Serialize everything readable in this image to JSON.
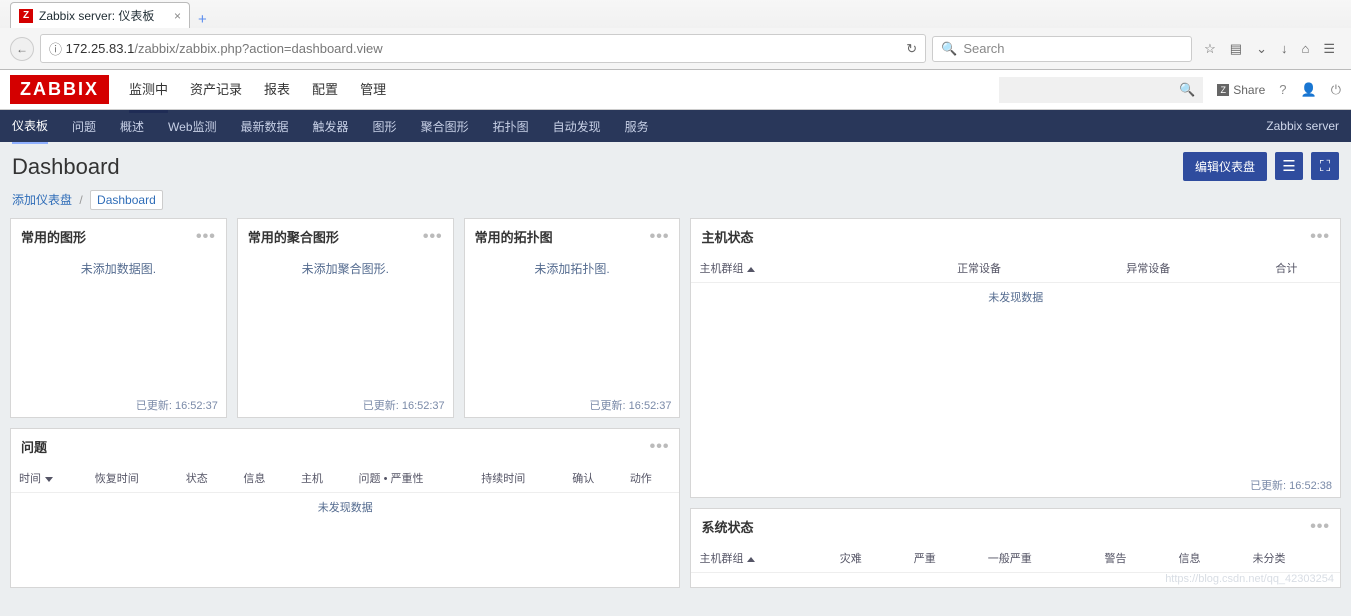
{
  "browser": {
    "tab_title": "Zabbix server: 仪表板",
    "url_host": "172.25.83.1",
    "url_path": "/zabbix/zabbix.php?action=dashboard.view",
    "search_placeholder": "Search"
  },
  "header": {
    "logo": "ZABBIX",
    "nav": [
      "监测中",
      "资产记录",
      "报表",
      "配置",
      "管理"
    ],
    "active_nav": 0,
    "share": "Share",
    "search_placeholder": ""
  },
  "subnav": {
    "items": [
      "仪表板",
      "问题",
      "概述",
      "Web监测",
      "最新数据",
      "触发器",
      "图形",
      "聚合图形",
      "拓扑图",
      "自动发现",
      "服务"
    ],
    "active": 0,
    "server_label": "Zabbix server"
  },
  "page": {
    "title": "Dashboard",
    "edit_btn": "编辑仪表盘",
    "crumb_add": "添加仪表盘",
    "crumb_current": "Dashboard"
  },
  "widgets": {
    "fav_graphs": {
      "title": "常用的图形",
      "empty": "未添加数据图.",
      "updated": "已更新: 16:52:37"
    },
    "fav_screens": {
      "title": "常用的聚合图形",
      "empty": "未添加聚合图形.",
      "updated": "已更新: 16:52:37"
    },
    "fav_maps": {
      "title": "常用的拓扑图",
      "empty": "未添加拓扑图.",
      "updated": "已更新: 16:52:37"
    },
    "problems": {
      "title": "问题",
      "cols": [
        "时间",
        "恢复时间",
        "状态",
        "信息",
        "主机",
        "问题 • 严重性",
        "持续时间",
        "确认",
        "动作"
      ],
      "empty": "未发现数据"
    },
    "host_status": {
      "title": "主机状态",
      "cols": [
        "主机群组",
        "正常设备",
        "异常设备",
        "合计"
      ],
      "empty": "未发现数据",
      "updated": "已更新: 16:52:38"
    },
    "sys_status": {
      "title": "系统状态",
      "cols": [
        "主机群组",
        "灾难",
        "严重",
        "一般严重",
        "警告",
        "信息",
        "未分类"
      ]
    }
  },
  "watermark": "https://blog.csdn.net/qq_42303254"
}
